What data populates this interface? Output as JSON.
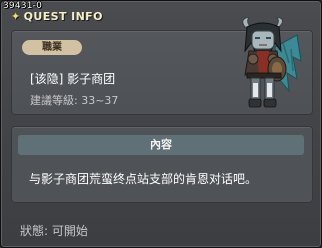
{
  "quest_id": "39431-0",
  "title": "QUEST INFO",
  "job_label": "職業",
  "quest_name": "[该隐] 影子商团",
  "level_requirement": "建議等級: 33~37",
  "content_header": "內容",
  "content_text": "与影子商团荒蛮终点站支部的肯恩对话吧。",
  "status": "狀態: 可開始",
  "npc_icon": "demon-npc-portrait"
}
